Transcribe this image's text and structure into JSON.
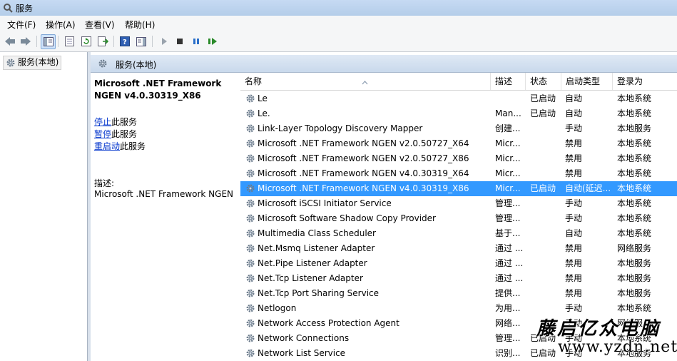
{
  "window": {
    "title": "服务"
  },
  "menu": [
    "文件(F)",
    "操作(A)",
    "查看(V)",
    "帮助(H)"
  ],
  "tree": {
    "item": "服务(本地)"
  },
  "pane": {
    "title": "服务(本地)"
  },
  "detail": {
    "service_name": "Microsoft .NET Framework NGEN v4.0.30319_X86",
    "stop_link": "停止",
    "stop_suffix": "此服务",
    "pause_link": "暂停",
    "pause_suffix": "此服务",
    "restart_link": "重启动",
    "restart_suffix": "此服务",
    "desc_label": "描述:",
    "desc_text": "Microsoft .NET Framework NGEN"
  },
  "columns": {
    "name": "名称",
    "desc": "描述",
    "status": "状态",
    "startup": "启动类型",
    "logon": "登录为"
  },
  "rows": [
    {
      "name": "Le",
      "desc": "",
      "status": "已启动",
      "startup": "自动",
      "logon": "本地系统"
    },
    {
      "name": "Le.",
      "desc": "Man...",
      "status": "已启动",
      "startup": "自动",
      "logon": "本地系统"
    },
    {
      "name": "Link-Layer Topology Discovery Mapper",
      "desc": "创建...",
      "status": "",
      "startup": "手动",
      "logon": "本地服务"
    },
    {
      "name": "Microsoft .NET Framework NGEN v2.0.50727_X64",
      "desc": "Micr...",
      "status": "",
      "startup": "禁用",
      "logon": "本地系统"
    },
    {
      "name": "Microsoft .NET Framework NGEN v2.0.50727_X86",
      "desc": "Micr...",
      "status": "",
      "startup": "禁用",
      "logon": "本地系统"
    },
    {
      "name": "Microsoft .NET Framework NGEN v4.0.30319_X64",
      "desc": "Micr...",
      "status": "",
      "startup": "禁用",
      "logon": "本地系统"
    },
    {
      "name": "Microsoft .NET Framework NGEN v4.0.30319_X86",
      "desc": "Micr...",
      "status": "已启动",
      "startup": "自动(延迟...",
      "logon": "本地系统",
      "selected": true
    },
    {
      "name": "Microsoft iSCSI Initiator Service",
      "desc": "管理...",
      "status": "",
      "startup": "手动",
      "logon": "本地系统"
    },
    {
      "name": "Microsoft Software Shadow Copy Provider",
      "desc": "管理...",
      "status": "",
      "startup": "手动",
      "logon": "本地系统"
    },
    {
      "name": "Multimedia Class Scheduler",
      "desc": "基于...",
      "status": "",
      "startup": "自动",
      "logon": "本地系统"
    },
    {
      "name": "Net.Msmq Listener Adapter",
      "desc": "通过 ...",
      "status": "",
      "startup": "禁用",
      "logon": "网络服务"
    },
    {
      "name": "Net.Pipe Listener Adapter",
      "desc": "通过 ...",
      "status": "",
      "startup": "禁用",
      "logon": "本地服务"
    },
    {
      "name": "Net.Tcp Listener Adapter",
      "desc": "通过 ...",
      "status": "",
      "startup": "禁用",
      "logon": "本地服务"
    },
    {
      "name": "Net.Tcp Port Sharing Service",
      "desc": "提供...",
      "status": "",
      "startup": "禁用",
      "logon": "本地服务"
    },
    {
      "name": "Netlogon",
      "desc": "为用...",
      "status": "",
      "startup": "手动",
      "logon": "本地系统"
    },
    {
      "name": "Network Access Protection Agent",
      "desc": "网络...",
      "status": "",
      "startup": "手动",
      "logon": "网络服务"
    },
    {
      "name": "Network Connections",
      "desc": "管理...",
      "status": "已启动",
      "startup": "手动",
      "logon": "本地系统"
    },
    {
      "name": "Network List Service",
      "desc": "识别...",
      "status": "已启动",
      "startup": "手动",
      "logon": "本地服务"
    }
  ],
  "watermark": {
    "line1": "藤启亿众电脑",
    "line2": "www.yzdn.net"
  },
  "colors": {
    "selection": "#3399ff",
    "link": "#0033cc",
    "header_bg": "#c9d9ec"
  }
}
